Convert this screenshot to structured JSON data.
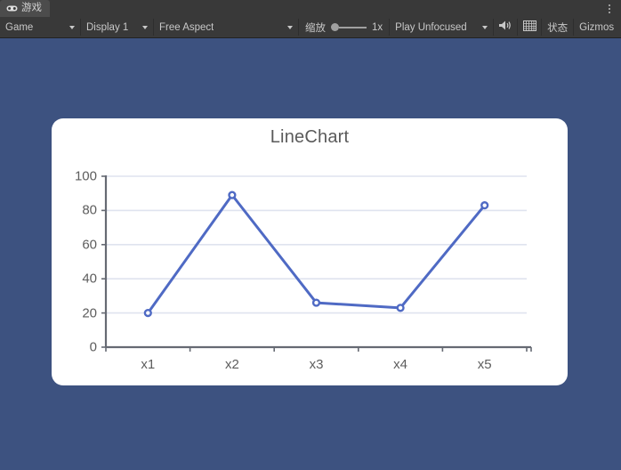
{
  "window": {
    "tab": {
      "label": "游戏",
      "icon": "gamepad-icon"
    },
    "menu_icon": "kebab-menu-icon"
  },
  "toolbar": {
    "game_select": {
      "value": "Game",
      "icon": "chevron-down-icon"
    },
    "display_select": {
      "value": "Display 1",
      "icon": "chevron-down-icon"
    },
    "aspect_select": {
      "value": "Free Aspect",
      "icon": "chevron-down-icon"
    },
    "zoom": {
      "label": "缩放",
      "value": "1x",
      "icon": "slider-handle-icon"
    },
    "play_mode_select": {
      "value": "Play Unfocused",
      "icon": "chevron-down-icon"
    },
    "mute_audio": {
      "icon": "speaker-icon"
    },
    "stats_grid": {
      "icon": "grid-icon"
    },
    "stats": {
      "label": "状态"
    },
    "gizmos": {
      "label": "Gizmos"
    }
  },
  "chart_data": {
    "type": "line",
    "title": "LineChart",
    "xlabel": "",
    "ylabel": "",
    "categories": [
      "x1",
      "x2",
      "x3",
      "x4",
      "x5"
    ],
    "values": [
      20,
      89,
      26,
      23,
      83
    ],
    "series": [
      {
        "name": "LineChart",
        "values": [
          20,
          89,
          26,
          23,
          83
        ]
      }
    ],
    "ylim": [
      0,
      100
    ],
    "yticks": [
      0,
      20,
      40,
      60,
      80,
      100
    ],
    "grid": true,
    "legend": "none",
    "line_color": "#4f6ac4",
    "marker": "circle-open",
    "marker_color": "#4f6ac4",
    "axis_color": "#666a73",
    "gridline_color": "#dfe3ef",
    "title_color": "#5a5a5a",
    "tick_label_color": "#5d5d5d",
    "background": "#ffffff"
  },
  "colors": {
    "game_view_background": "#3d5280",
    "toolbar_background": "#393939",
    "tab_active_background": "#4c4c4c",
    "text": "#c8c8c8"
  }
}
